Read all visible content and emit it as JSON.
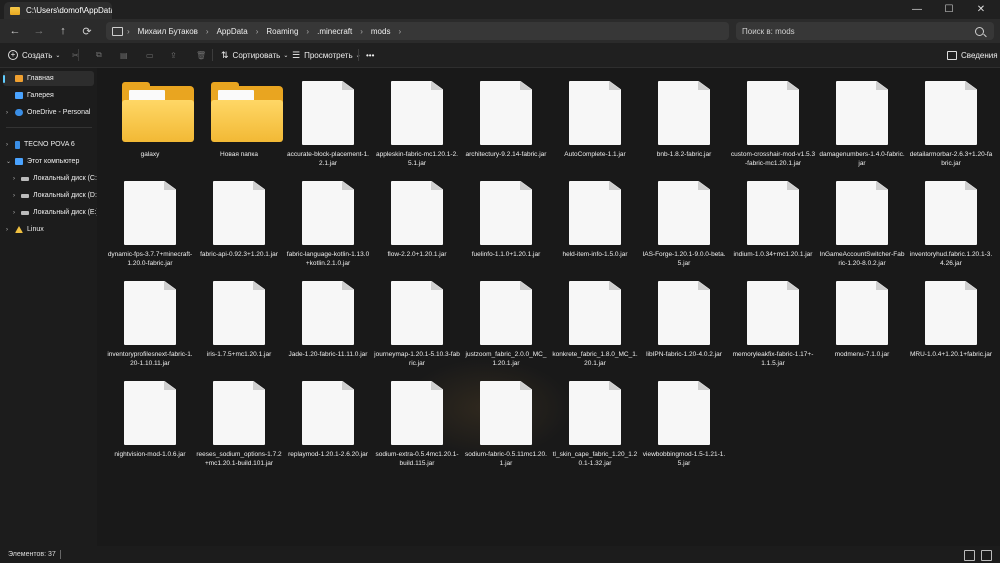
{
  "tab": {
    "title": "C:\\Users\\domof\\AppData\\Roa"
  },
  "window": {
    "minimize": "—",
    "maximize": "☐",
    "close": "✕"
  },
  "nav": {
    "back": "←",
    "forward": "→",
    "up": "↑",
    "refresh": "⟳"
  },
  "breadcrumbs": [
    "Михаил Бутаков",
    "AppData",
    "Roaming",
    ".minecraft",
    "mods"
  ],
  "search": {
    "placeholder": "Поиск в: mods"
  },
  "toolbar": {
    "create": "Создать",
    "sort": "Сортировать",
    "view": "Просмотреть",
    "more": "•••",
    "details": "Сведения"
  },
  "sidebar": {
    "items": [
      {
        "label": "Главная",
        "icon": "home-icon",
        "color": "#f0a030"
      },
      {
        "label": "Галерея",
        "icon": "gallery-icon",
        "color": "#4aa3ff"
      },
      {
        "label": "OneDrive - Personal",
        "icon": "cloud-icon",
        "color": "#3a8ee6"
      },
      {
        "label": "TECNO POVA 6",
        "icon": "phone-icon",
        "color": "#3a8ee6"
      },
      {
        "label": "Этот компьютер",
        "icon": "computer-icon",
        "color": "#4aa3ff"
      },
      {
        "label": "Локальный диск (C:)",
        "icon": "drive-icon",
        "color": "#bbbbbb"
      },
      {
        "label": "Локальный диск (D:)",
        "icon": "drive-icon",
        "color": "#bbbbbb"
      },
      {
        "label": "Локальный диск (E:)",
        "icon": "drive-icon",
        "color": "#bbbbbb"
      },
      {
        "label": "Linux",
        "icon": "linux-icon",
        "color": "#f0c040"
      }
    ]
  },
  "files": [
    {
      "name": "galaxy",
      "type": "folder"
    },
    {
      "name": "Новая папка",
      "type": "folder"
    },
    {
      "name": "accurate-block-placement-1.2.1.jar",
      "type": "file"
    },
    {
      "name": "appleskin-fabric-mc1.20.1-2.5.1.jar",
      "type": "file"
    },
    {
      "name": "architectury-9.2.14-fabric.jar",
      "type": "file"
    },
    {
      "name": "AutoComplete-1.1.jar",
      "type": "file"
    },
    {
      "name": "bnb-1.8.2-fabric.jar",
      "type": "file"
    },
    {
      "name": "custom-crosshair-mod-v1.5.3-fabric-mc1.20.1.jar",
      "type": "file"
    },
    {
      "name": "damagenumbers-1.4.0-fabric.jar",
      "type": "file"
    },
    {
      "name": "detailarmorbar-2.6.3+1.20-fabric.jar",
      "type": "file"
    },
    {
      "name": "dynamic-fps-3.7.7+minecraft-1.20.0-fabric.jar",
      "type": "file"
    },
    {
      "name": "fabric-api-0.92.3+1.20.1.jar",
      "type": "file"
    },
    {
      "name": "fabric-language-kotlin-1.13.0+kotlin.2.1.0.jar",
      "type": "file"
    },
    {
      "name": "flow-2.2.0+1.20.1.jar",
      "type": "file"
    },
    {
      "name": "fuelinfo-1.1.0+1.20.1.jar",
      "type": "file"
    },
    {
      "name": "held-item-info-1.5.0.jar",
      "type": "file"
    },
    {
      "name": "IAS-Forge-1.20.1-9.0.0-beta.5.jar",
      "type": "file"
    },
    {
      "name": "indium-1.0.34+mc1.20.1.jar",
      "type": "file"
    },
    {
      "name": "InGameAccountSwitcher-Fabric-1.20-8.0.2.jar",
      "type": "file"
    },
    {
      "name": "inventoryhud.fabric.1.20.1-3.4.26.jar",
      "type": "file"
    },
    {
      "name": "inventoryprofilesnext-fabric-1.20-1.10.11.jar",
      "type": "file"
    },
    {
      "name": "iris-1.7.5+mc1.20.1.jar",
      "type": "file"
    },
    {
      "name": "Jade-1.20-fabric-11.11.0.jar",
      "type": "file"
    },
    {
      "name": "journeymap-1.20.1-5.10.3-fabric.jar",
      "type": "file"
    },
    {
      "name": "justzoom_fabric_2.0.0_MC_1.20.1.jar",
      "type": "file"
    },
    {
      "name": "konkrete_fabric_1.8.0_MC_1.20.1.jar",
      "type": "file"
    },
    {
      "name": "libIPN-fabric-1.20-4.0.2.jar",
      "type": "file"
    },
    {
      "name": "memoryleakfix-fabric-1.17+-1.1.5.jar",
      "type": "file"
    },
    {
      "name": "modmenu-7.1.0.jar",
      "type": "file"
    },
    {
      "name": "MRU-1.0.4+1.20.1+fabric.jar",
      "type": "file"
    },
    {
      "name": "nightvision-mod-1.0.6.jar",
      "type": "file"
    },
    {
      "name": "reeses_sodium_options-1.7.2+mc1.20.1-build.101.jar",
      "type": "file"
    },
    {
      "name": "replaymod-1.20.1-2.6.20.jar",
      "type": "file"
    },
    {
      "name": "sodium-extra-0.5.4mc1.20.1-build.115.jar",
      "type": "file"
    },
    {
      "name": "sodium-fabric-0.5.11mc1.20.1.jar",
      "type": "file"
    },
    {
      "name": "tl_skin_cape_fabric_1.20_1.20.1-1.32.jar",
      "type": "file"
    },
    {
      "name": "viewbobbingmod-1.5-1.21-1.5.jar",
      "type": "file"
    }
  ],
  "status": {
    "count": "Элементов: 37"
  }
}
